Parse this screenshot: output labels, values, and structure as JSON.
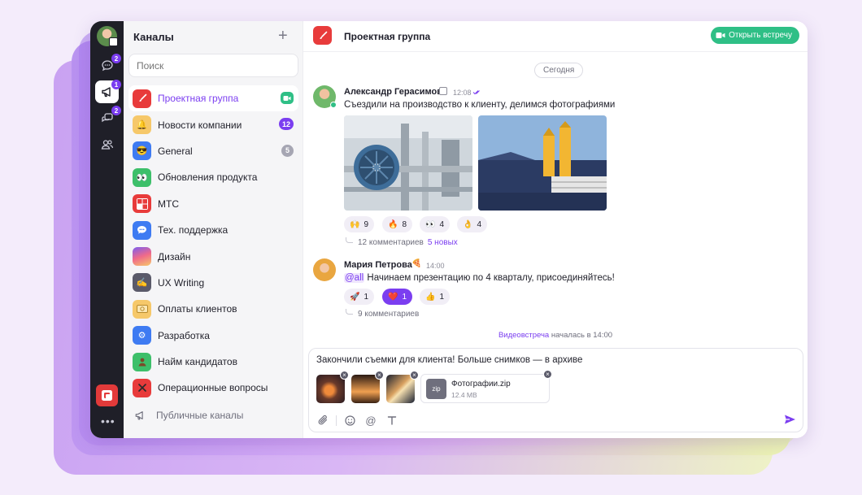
{
  "sidebar": {
    "title": "Каналы",
    "add": "+",
    "search_placeholder": "Поиск",
    "rail_badges": [
      "2",
      "1",
      "2"
    ],
    "channels": [
      {
        "label": "Проектная группа",
        "icon": "brush-icon",
        "color": "#e83b3b",
        "active": true,
        "video": true
      },
      {
        "label": "Новости компании",
        "icon": "bell-icon",
        "color": "#f6c86a",
        "count": "12",
        "count_color": "#7b3ef0"
      },
      {
        "label": "General",
        "icon": "sunglasses-face-icon",
        "color": "#3e7bf2",
        "count": "5",
        "count_color": "#a6a6b3"
      },
      {
        "label": "Обновления продукта",
        "icon": "eyes-icon",
        "color": "#3dbf6a"
      },
      {
        "label": "МТС",
        "icon": "mts-logo-icon",
        "color": "#e83b3b"
      },
      {
        "label": "Тех. поддержка",
        "icon": "chat-bubble-icon",
        "color": "#3e7bf2"
      },
      {
        "label": "Дизайн",
        "icon": "gradient-icon",
        "color": "#f08a5d"
      },
      {
        "label": "UX Writing",
        "icon": "writing-hand-icon",
        "color": "#5a5a6a"
      },
      {
        "label": "Оплаты клиентов",
        "icon": "money-icon",
        "color": "#f6c86a"
      },
      {
        "label": "Разработка",
        "icon": "gear-icon",
        "color": "#3e7bf2"
      },
      {
        "label": "Найм кандидатов",
        "icon": "person-icon",
        "color": "#3dbf6a"
      },
      {
        "label": "Операционные вопросы",
        "icon": "tools-icon",
        "color": "#e83b3b"
      }
    ],
    "public": "Публичные каналы"
  },
  "header": {
    "title": "Проектная группа",
    "meet_button": "Открыть встречу"
  },
  "feed": {
    "day": "Сегодня",
    "messages": [
      {
        "author": "Александр Герасимов",
        "time": "12:08",
        "text": "Съездили на производство к клиенту, делимся фотографиями",
        "reactions": [
          {
            "emoji": "🙌",
            "count": "9"
          },
          {
            "emoji": "🔥",
            "count": "8"
          },
          {
            "emoji": "👀",
            "count": "4"
          },
          {
            "emoji": "👌",
            "count": "4"
          }
        ],
        "comments": "12 комментариев",
        "new": "5 новых"
      },
      {
        "author": "Мария Петрова",
        "time": "14:00",
        "mention": "@all",
        "text": "Начинаем презентацию по 4 кварталу, присоединяйтесь!",
        "reactions": [
          {
            "emoji": "🚀",
            "count": "1"
          },
          {
            "emoji": "❤️",
            "count": "1"
          },
          {
            "emoji": "👍",
            "count": "1"
          }
        ],
        "comments": "9 комментариев"
      }
    ],
    "system_link": "Видеовстреча",
    "system_text": "началась в 14:00"
  },
  "composer": {
    "draft": "Закончили съемки для клиента! Больше снимков — в архиве",
    "file_ext": "zip",
    "file_name": "Фотографии.zip",
    "file_size": "12.4 MB"
  },
  "colors": {
    "accent": "#7b3ef0",
    "green": "#2fbf86",
    "red": "#e83b3b"
  }
}
